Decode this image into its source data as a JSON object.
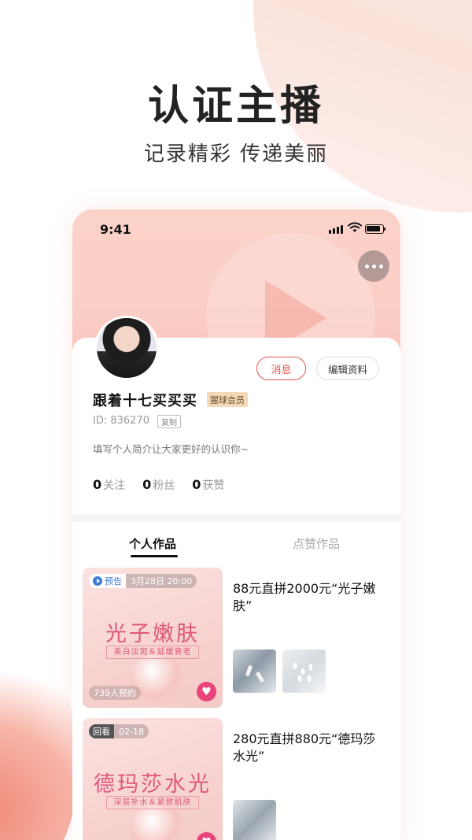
{
  "headline": "认证主播",
  "subline": "记录精彩  传递美丽",
  "status_bar": {
    "time": "9:41"
  },
  "profile": {
    "message_button": "消息",
    "edit_button": "编辑资料",
    "name": "跟着十七买买买",
    "member_badge": "猩球会员",
    "id_text": "ID: 836270",
    "copy_label": "复制",
    "bio": "填写个人简介让大家更好的认识你~",
    "stats": [
      {
        "value": "0",
        "label": "关注"
      },
      {
        "value": "0",
        "label": "粉丝"
      },
      {
        "value": "0",
        "label": "获赞"
      }
    ]
  },
  "tabs": {
    "works": "个人作品",
    "liked": "点赞作品"
  },
  "items": [
    {
      "tag_type": "预告",
      "tag_time": "3月28日 20:00",
      "thumb_title": "光子嫩肤",
      "thumb_subtitle": "美白淡斑＆延缓衰老",
      "count": "739人预约",
      "title": "88元直拼2000元“光子嫩肤”"
    },
    {
      "tag_type": "回看",
      "tag_time": "02-18",
      "thumb_title": "德玛莎水光",
      "thumb_subtitle": "深层补水＆紧致肌肤",
      "count": "",
      "title": "280元直拼880元“德玛莎水光”"
    }
  ],
  "colors": {
    "accent": "#e0574a",
    "heart": "#e8457a",
    "tag_blue": "#3e7bd8"
  }
}
